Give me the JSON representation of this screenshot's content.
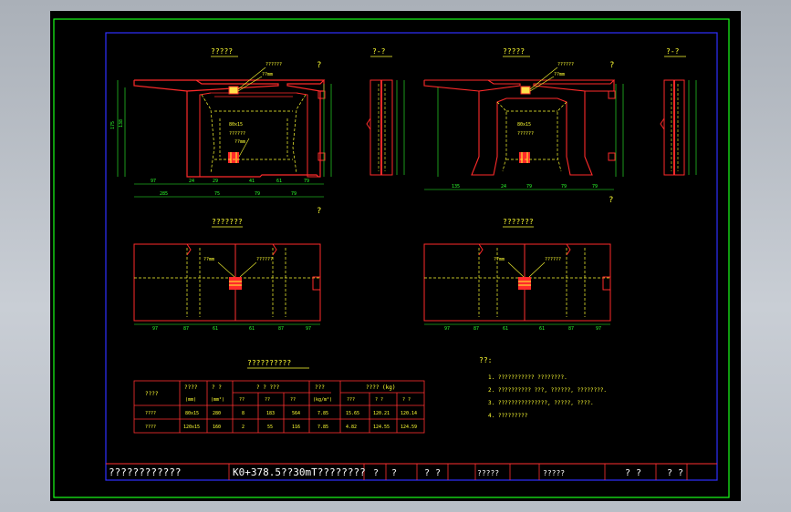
{
  "colors": {
    "background": "#000000",
    "frame_outer": "#19ff19",
    "frame_inner": "#3030ff",
    "section": "#ff2a2a",
    "dim": "#2dff2d",
    "text": "#ffff33",
    "rebar": "#ffd23c",
    "center": "#ff3030",
    "tablebox": "#ff3030"
  },
  "views": {
    "sec1_title": "?????",
    "sec2_title": "?-?",
    "sec3_title": "?????",
    "sec4_title": "?-?",
    "plan1_title": "???????",
    "plan2_title": "???????",
    "marker": "?",
    "plate_note": "??????",
    "bolt_note": "??????",
    "pad_note": "??mm"
  },
  "dimensions": {
    "sec1_bottom": [
      "97",
      "24",
      "29",
      "41",
      "61",
      "79"
    ],
    "sec1_bottom2": [
      "285",
      "75",
      "79",
      "79",
      "79"
    ],
    "sec1_left": "175",
    "sec1_left2": "138",
    "sec3_bottom": [
      "135",
      "24",
      "79",
      "79",
      "79"
    ],
    "plan_bottom": [
      "97",
      "87",
      "61",
      "61",
      "87",
      "97"
    ]
  },
  "table": {
    "title": "??????????",
    "header1": [
      "????",
      "????",
      "? ?",
      "? ? ???",
      "???",
      "????  (kg)"
    ],
    "header2": [
      "(mm)",
      "(mm²)",
      "??",
      "??",
      "??",
      "(kg/m²)",
      "???",
      "? ?",
      "? ?"
    ],
    "rows": [
      [
        "????",
        "80x15",
        "280",
        "8",
        "183",
        "564",
        "7.85",
        "15.65",
        "120.21",
        "120.14"
      ],
      [
        "????",
        "120x15",
        "160",
        "2",
        "55",
        "116",
        "7.85",
        "4.82",
        "124.55",
        "124.59"
      ]
    ]
  },
  "notes": {
    "title": "??:",
    "items": [
      "1. ??????????? ????????.",
      "2. ?????????? ???, ??????, ????????.",
      "3. ???????????????, ?????, ????.",
      "4. ?????????"
    ]
  },
  "titleblock": {
    "project": "????????????",
    "drawing": "K0+378.5??30mT????????",
    "cells": [
      "?",
      "?",
      "?  ?",
      "?????",
      "?????",
      "?  ?",
      "?  ?"
    ]
  }
}
